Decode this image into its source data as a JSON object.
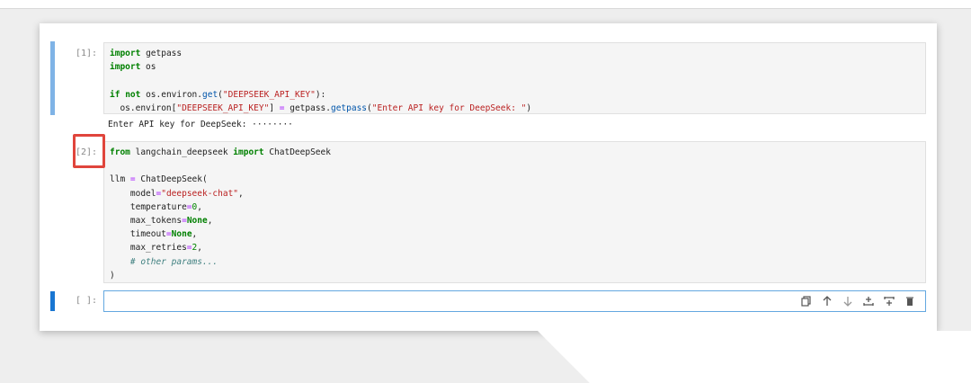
{
  "cells": [
    {
      "prompt": "[1]:",
      "code_lines": [
        "import getpass",
        "import os",
        "",
        "if not os.environ.get(\"DEEPSEEK_API_KEY\"):",
        "  os.environ[\"DEEPSEEK_API_KEY\"] = getpass.getpass(\"Enter API key for DeepSeek: \")"
      ],
      "output": "Enter API key for DeepSeek:  ········"
    },
    {
      "prompt": "[2]:",
      "code_lines": [
        "from langchain_deepseek import ChatDeepSeek",
        "",
        "llm = ChatDeepSeek(",
        "    model=\"deepseek-chat\",",
        "    temperature=0,",
        "    max_tokens=None,",
        "    timeout=None,",
        "    max_retries=2,",
        "    # other params...",
        ")"
      ]
    },
    {
      "prompt": "[ ]:",
      "code_lines": [
        ""
      ]
    }
  ],
  "toolbar": {
    "icons": [
      "copy-icon",
      "move-up-icon",
      "move-down-icon",
      "insert-above-icon",
      "insert-below-icon",
      "delete-icon"
    ]
  },
  "colors": {
    "cell_bar_inactive": "#7fb3e6",
    "cell_bar_active": "#1976d2",
    "highlight": "#e0453c"
  }
}
